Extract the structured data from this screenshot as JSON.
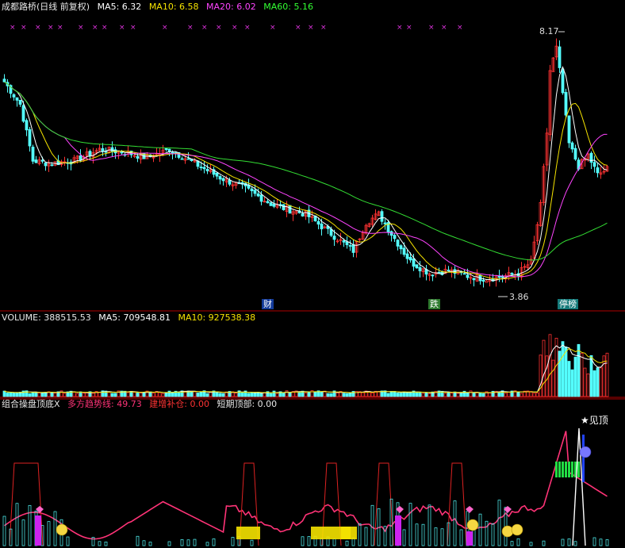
{
  "header": {
    "title": "成都路桥(日线 前复权)",
    "ma5": "MA5: 6.32",
    "ma10": "MA10: 6.58",
    "ma20": "MA20: 6.02",
    "ma60": "MA60: 5.16"
  },
  "volume_header": {
    "volume": "VOLUME: 388515.53",
    "ma5": "MA5: 709548.81",
    "ma10": "MA10: 927538.38"
  },
  "indicator_header": {
    "name": "组合操盘顶底X",
    "trend": "多方趋势线: 49.73",
    "add": "建增补仓: 0.00",
    "top": "短期顶部: 0.00"
  },
  "event_tags": [
    "财",
    "跌",
    "停榜"
  ],
  "annotations": {
    "high": "8.17",
    "low": "3.86",
    "see_top": "★见顶"
  },
  "colors": {
    "up": "#ff3232",
    "down": "#54ffff",
    "ma5": "#ffffff",
    "ma10": "#f5e300",
    "ma20": "#ff44ff",
    "ma60": "#33dd33",
    "trend": "#ff3377",
    "axis": "#b00000"
  },
  "chart_data": [
    {
      "type": "candlestick",
      "title": "成都路桥(日线 前复权)",
      "series": [
        {
          "name": "MA5",
          "last": 6.32
        },
        {
          "name": "MA10",
          "last": 6.58
        },
        {
          "name": "MA20",
          "last": 6.02
        },
        {
          "name": "MA60",
          "last": 5.16
        }
      ],
      "ylim": [
        3.5,
        8.6
      ],
      "key_values": {
        "high": 8.17,
        "low": 3.86
      },
      "waypoints": [
        [
          0,
          7.4
        ],
        [
          5,
          7.0
        ],
        [
          9,
          6.0
        ],
        [
          14,
          5.95
        ],
        [
          22,
          6.0
        ],
        [
          30,
          6.2
        ],
        [
          38,
          6.15
        ],
        [
          45,
          6.05
        ],
        [
          52,
          6.2
        ],
        [
          60,
          5.95
        ],
        [
          68,
          5.7
        ],
        [
          76,
          5.5
        ],
        [
          85,
          5.2
        ],
        [
          95,
          5.05
        ],
        [
          103,
          4.7
        ],
        [
          110,
          4.4
        ],
        [
          114,
          4.9
        ],
        [
          118,
          5.05
        ],
        [
          122,
          4.7
        ],
        [
          128,
          4.2
        ],
        [
          134,
          4.0
        ],
        [
          140,
          4.05
        ],
        [
          146,
          3.95
        ],
        [
          152,
          3.9
        ],
        [
          158,
          3.95
        ],
        [
          162,
          4.0
        ],
        [
          166,
          4.2
        ],
        [
          169,
          5.2
        ],
        [
          171,
          6.5
        ],
        [
          172,
          7.6
        ],
        [
          174,
          8.0
        ],
        [
          176,
          7.2
        ],
        [
          178,
          6.3
        ],
        [
          181,
          5.9
        ],
        [
          184,
          6.1
        ],
        [
          187,
          5.75
        ],
        [
          190,
          5.85
        ]
      ]
    },
    {
      "type": "bar",
      "title": "VOLUME",
      "series": [
        {
          "name": "VOLUME",
          "last": 388515.53
        },
        {
          "name": "MA5",
          "last": 709548.81
        },
        {
          "name": "MA10",
          "last": 927538.38
        }
      ]
    },
    {
      "type": "line",
      "title": "组合操盘顶底X",
      "series": [
        {
          "name": "多方趋势线",
          "last": 49.73
        },
        {
          "name": "建增补仓",
          "last": 0.0
        },
        {
          "name": "短期顶部",
          "last": 0.0
        }
      ]
    }
  ]
}
